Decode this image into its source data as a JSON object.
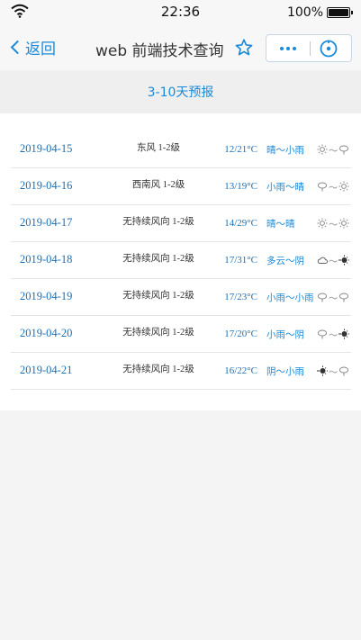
{
  "status_bar": {
    "time": "22:36",
    "battery": "100%"
  },
  "nav": {
    "back_label": "返回",
    "title": "web 前端技术查询"
  },
  "forecast": {
    "title": "3-10天预报",
    "rows": [
      {
        "date": "2019-04-15",
        "wind": "东风 1-2级",
        "temp": "12/21°C",
        "weather": "晴～小雨",
        "icon_from": "sun-icon",
        "icon_to": "rain-icon"
      },
      {
        "date": "2019-04-16",
        "wind": "西南风 1-2级",
        "temp": "13/19°C",
        "weather": "小雨～晴",
        "icon_from": "rain-icon",
        "icon_to": "sun-icon"
      },
      {
        "date": "2019-04-17",
        "wind": "无持续风向 1-2级",
        "temp": "14/29°C",
        "weather": "晴～晴",
        "icon_from": "sun-icon",
        "icon_to": "sun-icon"
      },
      {
        "date": "2019-04-18",
        "wind": "无持续风向 1-2级",
        "temp": "17/31°C",
        "weather": "多云～阴",
        "icon_from": "cloudy-icon",
        "icon_to": "overcast-icon"
      },
      {
        "date": "2019-04-19",
        "wind": "无持续风向 1-2级",
        "temp": "17/23°C",
        "weather": "小雨～小雨",
        "icon_from": "rain-icon",
        "icon_to": "rain-icon"
      },
      {
        "date": "2019-04-20",
        "wind": "无持续风向 1-2级",
        "temp": "17/20°C",
        "weather": "小雨～阴",
        "icon_from": "rain-icon",
        "icon_to": "overcast-icon"
      },
      {
        "date": "2019-04-21",
        "wind": "无持续风向 1-2级",
        "temp": "16/22°C",
        "weather": "阴～小雨",
        "icon_from": "overcast-icon",
        "icon_to": "rain-icon"
      }
    ]
  }
}
